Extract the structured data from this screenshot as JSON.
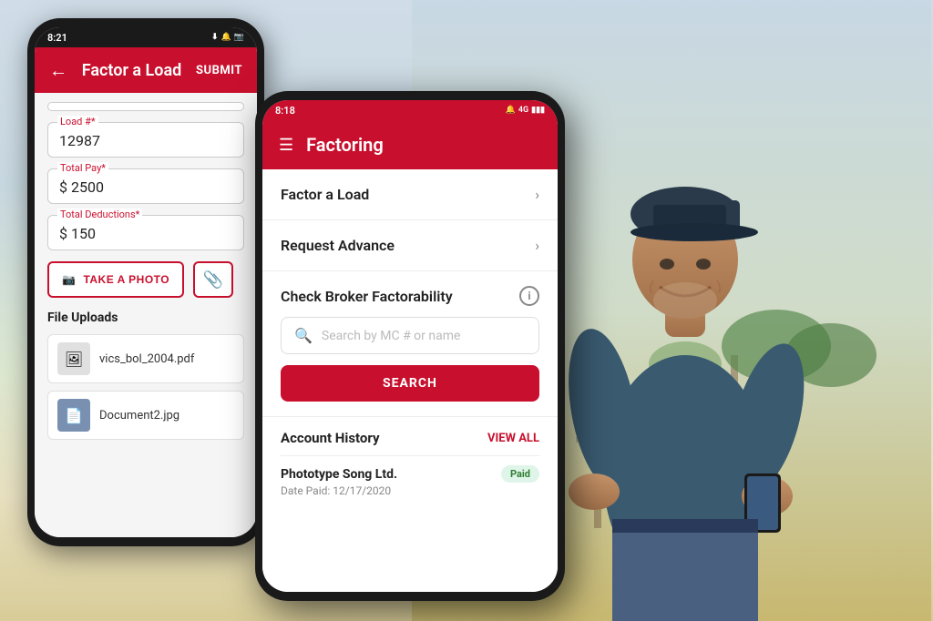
{
  "background": {
    "sky_color_top": "#c8d8e0",
    "sky_color_bottom": "#b8c890"
  },
  "back_phone": {
    "status_bar": {
      "time": "8:21",
      "icons": "⬇ 🔔 📷"
    },
    "header": {
      "back_label": "←",
      "title": "Factor a Load",
      "submit_label": "SUBMIT"
    },
    "form": {
      "load_field": {
        "label": "Load #",
        "required": "*",
        "value": "12987"
      },
      "total_pay_field": {
        "label": "Total Pay",
        "required": "*",
        "value": "$ 2500"
      },
      "total_deductions_field": {
        "label": "Total Deductions",
        "required": "*",
        "value": "$ 150"
      }
    },
    "buttons": {
      "take_photo": "TAKE A PHOTO",
      "camera_icon": "📷"
    },
    "file_uploads": {
      "section_label": "File Uploads",
      "files": [
        {
          "name": "vics_bol_2004.pdf",
          "icon": "🖼"
        },
        {
          "name": "Document2.jpg",
          "icon": "📄"
        }
      ]
    }
  },
  "front_phone": {
    "status_bar": {
      "time": "8:18",
      "icons": "🔔 4G ▪"
    },
    "header": {
      "menu_icon": "☰",
      "title": "Factoring"
    },
    "menu_items": [
      {
        "label": "Factor a Load",
        "has_chevron": true
      },
      {
        "label": "Request Advance",
        "has_chevron": true
      }
    ],
    "broker_section": {
      "title": "Check Broker Factorability",
      "info_icon_label": "i",
      "search_placeholder": "Search by MC # or name",
      "search_btn_label": "SEARCH"
    },
    "account_history": {
      "title": "Account History",
      "view_all_label": "VIEW ALL",
      "items": [
        {
          "company": "Phototype Song Ltd.",
          "status": "Paid",
          "date_label": "Date Paid: 12/17/2020"
        }
      ]
    }
  }
}
